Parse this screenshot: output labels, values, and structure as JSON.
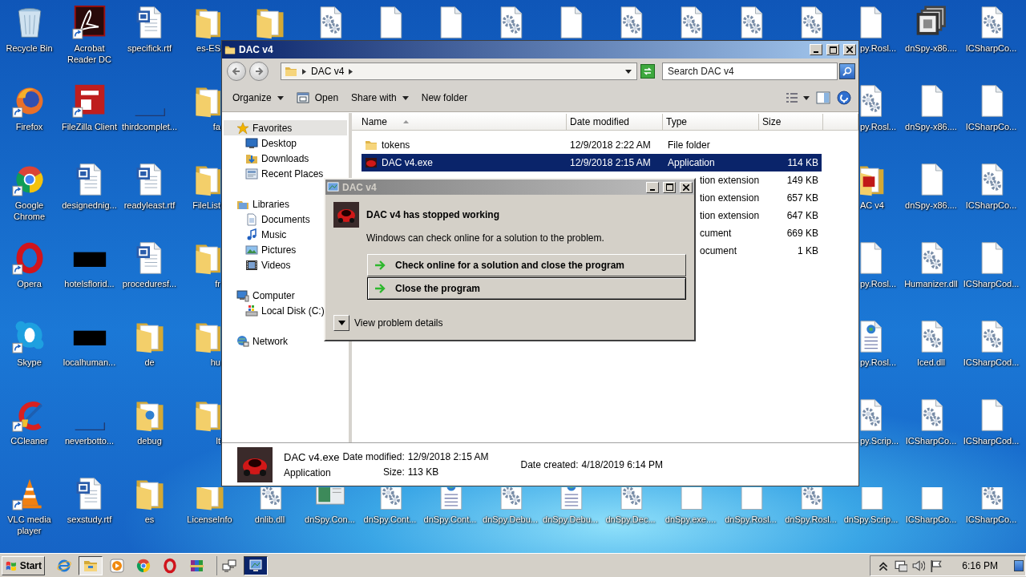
{
  "desktop": {
    "left_columns": [
      [
        {
          "label": "Recycle Bin",
          "kind": "recycle",
          "shortcut": false
        },
        {
          "label": "Firefox",
          "kind": "firefox",
          "shortcut": true
        },
        {
          "label": "Google Chrome",
          "kind": "chrome",
          "shortcut": true
        },
        {
          "label": "Opera",
          "kind": "opera",
          "shortcut": true
        },
        {
          "label": "Skype",
          "kind": "skype",
          "shortcut": true
        },
        {
          "label": "CCleaner",
          "kind": "ccleaner",
          "shortcut": true
        },
        {
          "label": "VLC media player",
          "kind": "vlc",
          "shortcut": true
        }
      ],
      [
        {
          "label": "Acrobat Reader DC",
          "kind": "acrobat",
          "shortcut": true
        },
        {
          "label": "FileZilla Client",
          "kind": "filezilla",
          "shortcut": true
        },
        {
          "label": "designednig...",
          "kind": "word",
          "shortcut": false
        },
        {
          "label": "hotelsflorid...",
          "kind": "dark",
          "shortcut": false
        },
        {
          "label": "localhuman...",
          "kind": "dark",
          "shortcut": false
        },
        {
          "label": "neverbotto...",
          "kind": "line",
          "shortcut": false
        },
        {
          "label": "sexstudy.rtf",
          "kind": "word",
          "shortcut": false
        }
      ],
      [
        {
          "label": "specifick.rtf",
          "kind": "word",
          "shortcut": false
        },
        {
          "label": "thirdcomplet...",
          "kind": "line",
          "shortcut": false
        },
        {
          "label": "readyleast.rtf",
          "kind": "word",
          "shortcut": false
        },
        {
          "label": "proceduresf...",
          "kind": "word",
          "shortcut": false
        },
        {
          "label": "de",
          "kind": "folder",
          "shortcut": false
        },
        {
          "label": "debug",
          "kind": "folder_doc",
          "shortcut": false
        },
        {
          "label": "es",
          "kind": "folder",
          "shortcut": false
        }
      ],
      [
        {
          "label": "es-ES",
          "kind": "folder",
          "shortcut": false
        },
        {
          "label": "fa",
          "kind": "folder",
          "shortcut": false
        },
        {
          "label": "FileList",
          "kind": "folder",
          "shortcut": false
        },
        {
          "label": "fr",
          "kind": "folder",
          "shortcut": false
        },
        {
          "label": "hu",
          "kind": "folder",
          "shortcut": false
        },
        {
          "label": "lt",
          "kind": "folder",
          "shortcut": false
        },
        {
          "label": "LicenseInfo",
          "kind": "folder",
          "shortcut": false
        }
      ]
    ],
    "top_peeks": [
      {
        "kind": "folder"
      },
      {
        "kind": "gear"
      },
      {
        "kind": "blank"
      },
      {
        "kind": "blank"
      },
      {
        "kind": "gear"
      },
      {
        "kind": "blank"
      },
      {
        "kind": "gear"
      },
      {
        "kind": "gear"
      },
      {
        "kind": "gear"
      },
      {
        "kind": "gear"
      }
    ],
    "right_columns": [
      [
        {
          "label": "py.Rosl...",
          "kind": "blank"
        },
        {
          "label": "py.Rosl...",
          "kind": "gear"
        },
        {
          "label": "AC v4",
          "kind": "dac_folder"
        },
        {
          "label": "py.Rosl...",
          "kind": "blank"
        },
        {
          "label": "py.Rosl...",
          "kind": "web"
        },
        {
          "label": "py.Scrip...",
          "kind": "gear"
        }
      ],
      [
        {
          "label": "dnSpy-x86....",
          "kind": "app32"
        },
        {
          "label": "dnSpy-x86....",
          "kind": "blank"
        },
        {
          "label": "dnSpy-x86....",
          "kind": "blank"
        },
        {
          "label": "Humanizer.dll",
          "kind": "gear"
        },
        {
          "label": "Iced.dll",
          "kind": "gear"
        },
        {
          "label": "ICSharpCo...",
          "kind": "gear"
        }
      ],
      [
        {
          "label": "ICSharpCo...",
          "kind": "gear"
        },
        {
          "label": "ICSharpCo...",
          "kind": "blank"
        },
        {
          "label": "ICSharpCo...",
          "kind": "gear"
        },
        {
          "label": "ICSharpCod...",
          "kind": "blank"
        },
        {
          "label": "ICSharpCod...",
          "kind": "gear"
        },
        {
          "label": "ICSharpCod...",
          "kind": "blank"
        }
      ]
    ],
    "bottom_row": [
      {
        "label": "dnlib.dll",
        "kind": "gear"
      },
      {
        "label": "dnSpy.Con...",
        "kind": "image"
      },
      {
        "label": "dnSpy.Cont...",
        "kind": "gear"
      },
      {
        "label": "dnSpy.Cont...",
        "kind": "web"
      },
      {
        "label": "dnSpy.Debu...",
        "kind": "gear"
      },
      {
        "label": "dnSpy.Debu...",
        "kind": "web"
      },
      {
        "label": "dnSpy.Dec...",
        "kind": "gear"
      },
      {
        "label": "dnSpy.exe....",
        "kind": "blank"
      },
      {
        "label": "dnSpy.Rosl...",
        "kind": "blank"
      },
      {
        "label": "dnSpy.Rosl...",
        "kind": "gear"
      },
      {
        "label": "dnSpy.Scrip...",
        "kind": "blank"
      },
      {
        "label": "ICSharpCo...",
        "kind": "blank"
      },
      {
        "label": "ICSharpCo...",
        "kind": "gear"
      }
    ]
  },
  "explorer": {
    "title": "DAC v4",
    "address": [
      "DAC v4"
    ],
    "search": {
      "placeholder": "Search DAC v4"
    },
    "toolbar": [
      {
        "label": "Organize",
        "kind": "plain",
        "dropdown": true
      },
      {
        "label": "Open",
        "kind": "open",
        "dropdown": false
      },
      {
        "label": "Share with",
        "kind": "plain",
        "dropdown": true
      },
      {
        "label": "New folder",
        "kind": "plain",
        "dropdown": false
      }
    ],
    "nav": [
      {
        "label": "Favorites",
        "kind": "star",
        "selected": true,
        "children": [
          {
            "label": "Desktop",
            "kind": "desktop",
            "selected": false
          },
          {
            "label": "Downloads",
            "kind": "downloads",
            "selected": false
          },
          {
            "label": "Recent Places",
            "kind": "recent",
            "selected": false
          }
        ]
      },
      {
        "label": "Libraries",
        "kind": "libraries",
        "selected": false,
        "children": [
          {
            "label": "Documents",
            "kind": "documents",
            "selected": false
          },
          {
            "label": "Music",
            "kind": "music",
            "selected": false
          },
          {
            "label": "Pictures",
            "kind": "pictures",
            "selected": false
          },
          {
            "label": "Videos",
            "kind": "videos",
            "selected": false
          }
        ]
      },
      {
        "label": "Computer",
        "kind": "computer",
        "selected": false,
        "children": [
          {
            "label": "Local Disk (C:)",
            "kind": "disk",
            "selected": false
          }
        ]
      },
      {
        "label": "Network",
        "kind": "network",
        "selected": false
      }
    ],
    "columns": [
      {
        "label": "Name",
        "sorted": true
      },
      {
        "label": "Date modified",
        "sorted": false
      },
      {
        "label": "Type",
        "sorted": false
      },
      {
        "label": "Size",
        "sorted": false
      }
    ],
    "rows": [
      {
        "name": "tokens",
        "kind": "folder",
        "date": "12/9/2018 2:22 AM",
        "type": "File folder",
        "selected": false
      },
      {
        "name": "DAC v4.exe",
        "kind": "app",
        "date": "12/9/2018 2:15 AM",
        "type": "Application",
        "size": "114 KB",
        "selected": true
      },
      {
        "type": "tion extension",
        "size": "149 KB",
        "selected": false
      },
      {
        "type": "tion extension",
        "size": "657 KB",
        "selected": false
      },
      {
        "type": "tion extension",
        "size": "647 KB",
        "selected": false
      },
      {
        "type": "cument",
        "size": "669 KB",
        "selected": false
      },
      {
        "type": "ocument",
        "size": "1 KB",
        "selected": false
      }
    ],
    "details": {
      "name": "DAC v4.exe",
      "type": "Application",
      "fields": [
        {
          "label": "Date modified:",
          "value": "12/9/2018 2:15 AM"
        },
        {
          "label": "Size:",
          "value": "113 KB"
        },
        {
          "label": "Date created:",
          "value": "4/18/2019 6:14 PM"
        }
      ]
    }
  },
  "dialog": {
    "title": "DAC v4",
    "heading": "DAC v4 has stopped working",
    "message": "Windows can check online for a solution to the problem.",
    "actions": [
      {
        "label": "Check online for a solution and close the program",
        "focused": false
      },
      {
        "label": "Close the program",
        "focused": true
      }
    ],
    "details_toggle": "View problem details"
  },
  "taskbar": {
    "start": "Start",
    "quick_launch": [
      {
        "kind": "ie",
        "selected": false
      },
      {
        "kind": "explorer",
        "selected": true
      },
      {
        "kind": "media",
        "selected": false
      },
      {
        "kind": "chrome",
        "selected": false
      },
      {
        "kind": "opera",
        "selected": false
      },
      {
        "kind": "winrar",
        "selected": false
      }
    ],
    "task_buttons": [
      {
        "kind": "network",
        "selected": false
      },
      {
        "kind": "dac",
        "selected": true
      }
    ],
    "tray": [
      {
        "kind": "chevron"
      },
      {
        "kind": "network"
      },
      {
        "kind": "volume"
      },
      {
        "kind": "flag"
      }
    ],
    "clock": "6:16 PM"
  }
}
